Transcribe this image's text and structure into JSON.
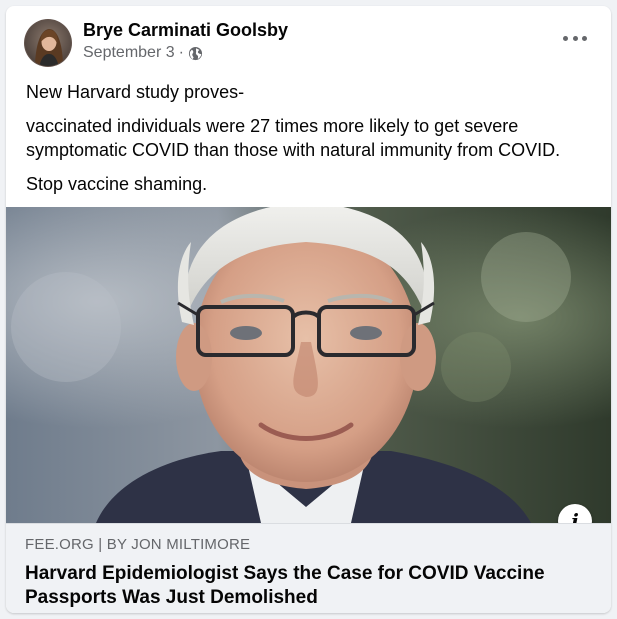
{
  "post": {
    "author": "Brye Carminati Goolsby",
    "date": "September 3",
    "separator": "·",
    "privacy_icon": "globe-icon",
    "more_icon": "more-options-icon",
    "text": {
      "line1": "New Harvard study proves-",
      "line2": "vaccinated individuals were 27 times more likely to get severe symptomatic COVID than those with natural immunity from COVID.",
      "line3": "Stop vaccine shaming."
    }
  },
  "link_preview": {
    "source": "FEE.ORG | BY JON MILTIMORE",
    "headline": "Harvard Epidemiologist Says the Case for COVID Vaccine Passports Was Just Demolished",
    "info_icon_label": "i"
  },
  "colors": {
    "background": "#f0f2f5",
    "card": "#ffffff",
    "text_primary": "#050505",
    "text_secondary": "#65676b"
  }
}
